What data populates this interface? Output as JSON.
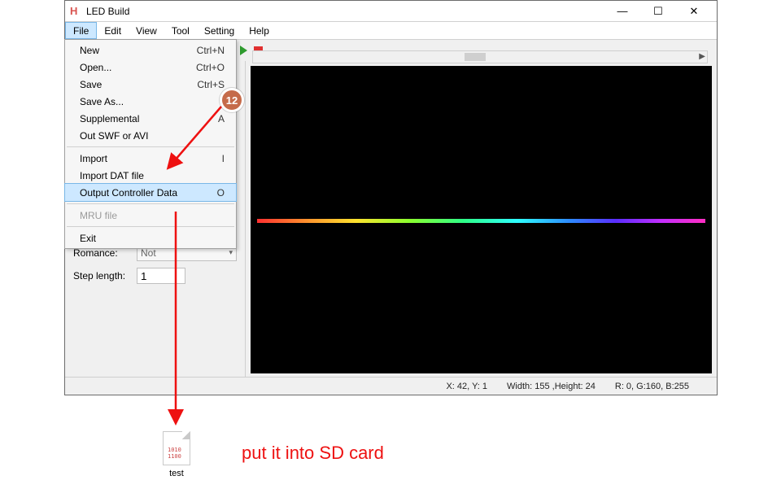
{
  "window": {
    "title": "LED Build"
  },
  "menubar": [
    "File",
    "Edit",
    "View",
    "Tool",
    "Setting",
    "Help"
  ],
  "file_menu": {
    "items": [
      {
        "label": "New",
        "accel": "Ctrl+N"
      },
      {
        "label": "Open...",
        "accel": "Ctrl+O"
      },
      {
        "label": "Save",
        "accel": "Ctrl+S"
      },
      {
        "label": "Save As..."
      },
      {
        "label": "Supplemental",
        "accel": "A"
      },
      {
        "label": "Out SWF or AVI"
      }
    ],
    "items2": [
      {
        "label": "Import",
        "accel": "I"
      },
      {
        "label": "Import DAT file"
      },
      {
        "label": "Output Controller Data",
        "accel": "O",
        "selected": true
      }
    ],
    "items3": [
      {
        "label": "MRU file",
        "disabled": true
      }
    ],
    "items4": [
      {
        "label": "Exit"
      }
    ]
  },
  "left_panel": {
    "romance_label": "Romance:",
    "romance_value": "Not",
    "step_label": "Step length:",
    "step_value": "1"
  },
  "statusbar": {
    "pos": "X: 42, Y: 1",
    "size": "Width: 155 ,Height: 24",
    "rgb": "R:  0, G:160, B:255"
  },
  "annotation": {
    "badge": "12",
    "instruction": "put it into SD card",
    "file_name": "test",
    "file_bits_line1": "1010",
    "file_bits_line2": "1100"
  }
}
